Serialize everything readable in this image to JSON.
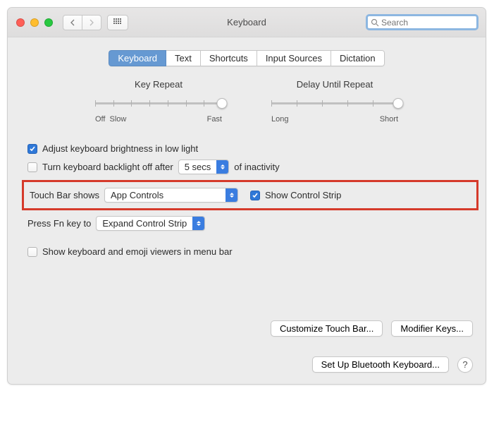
{
  "window": {
    "title": "Keyboard"
  },
  "search": {
    "placeholder": "Search"
  },
  "tabs": [
    {
      "label": "Keyboard",
      "active": true
    },
    {
      "label": "Text"
    },
    {
      "label": "Shortcuts"
    },
    {
      "label": "Input Sources"
    },
    {
      "label": "Dictation"
    }
  ],
  "sliders": {
    "key_repeat": {
      "title": "Key Repeat",
      "labels_left": "Off",
      "labels_left2": "Slow",
      "labels_right": "Fast",
      "ticks": 8,
      "value_pct": 100
    },
    "delay": {
      "title": "Delay Until Repeat",
      "labels_left": "Long",
      "labels_right": "Short",
      "ticks": 6,
      "value_pct": 100
    }
  },
  "options": {
    "adjust_brightness": {
      "label": "Adjust keyboard brightness in low light",
      "checked": true
    },
    "backlight_off": {
      "label_pre": "Turn keyboard backlight off after",
      "value": "5 secs",
      "label_post": "of inactivity",
      "checked": false
    },
    "touchbar": {
      "label_pre": "Touch Bar shows",
      "value": "App Controls",
      "show_strip_label": "Show Control Strip",
      "show_strip_checked": true
    },
    "fn_key": {
      "label_pre": "Press Fn key to",
      "value": "Expand Control Strip"
    },
    "show_viewers": {
      "label": "Show keyboard and emoji viewers in menu bar",
      "checked": false
    }
  },
  "buttons": {
    "customize": "Customize Touch Bar...",
    "modifier": "Modifier Keys...",
    "bluetooth": "Set Up Bluetooth Keyboard...",
    "help": "?"
  }
}
